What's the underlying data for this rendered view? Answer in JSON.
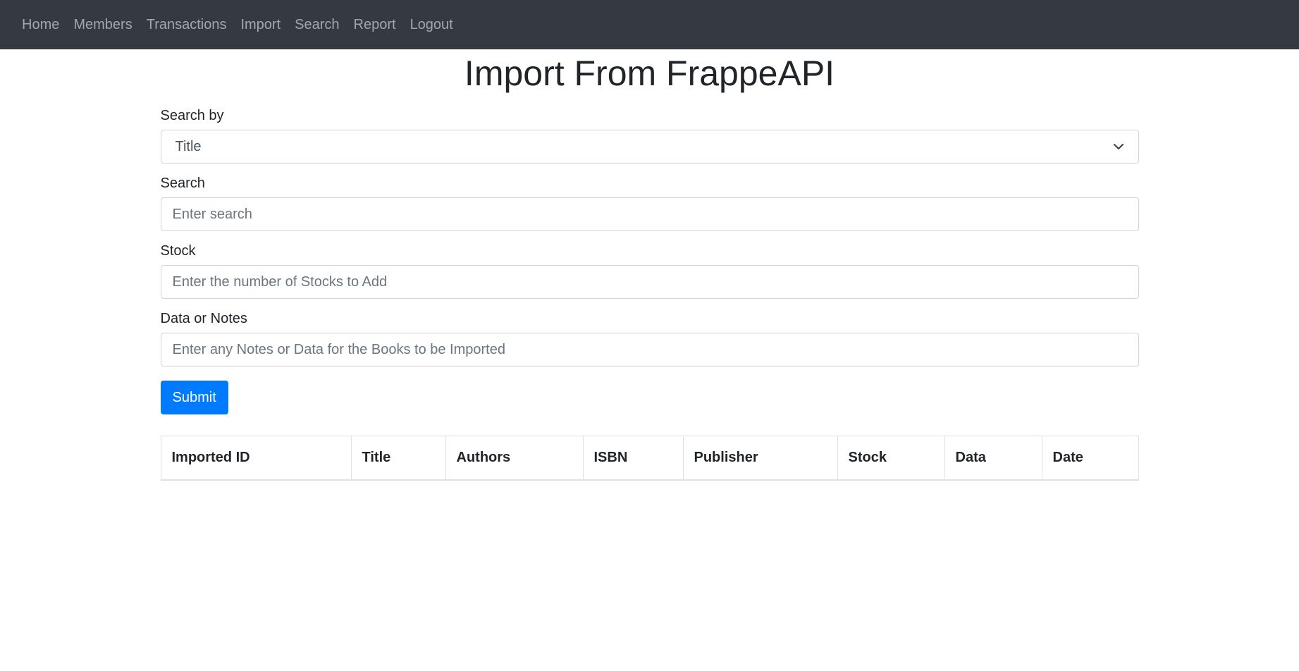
{
  "nav": {
    "items": [
      {
        "label": "Home"
      },
      {
        "label": "Members"
      },
      {
        "label": "Transactions"
      },
      {
        "label": "Import"
      },
      {
        "label": "Search"
      },
      {
        "label": "Report"
      },
      {
        "label": "Logout"
      }
    ]
  },
  "page": {
    "title": "Import From FrappeAPI"
  },
  "form": {
    "search_by": {
      "label": "Search by",
      "selected": "Title"
    },
    "search": {
      "label": "Search",
      "placeholder": "Enter search"
    },
    "stock": {
      "label": "Stock",
      "placeholder": "Enter the number of Stocks to Add"
    },
    "notes": {
      "label": "Data or Notes",
      "placeholder": "Enter any Notes or Data for the Books to be Imported"
    },
    "submit_label": "Submit"
  },
  "table": {
    "columns": [
      "Imported ID",
      "Title",
      "Authors",
      "ISBN",
      "Publisher",
      "Stock",
      "Data",
      "Date"
    ]
  },
  "colors": {
    "navbar_bg": "#343a40",
    "primary": "#007bff"
  }
}
